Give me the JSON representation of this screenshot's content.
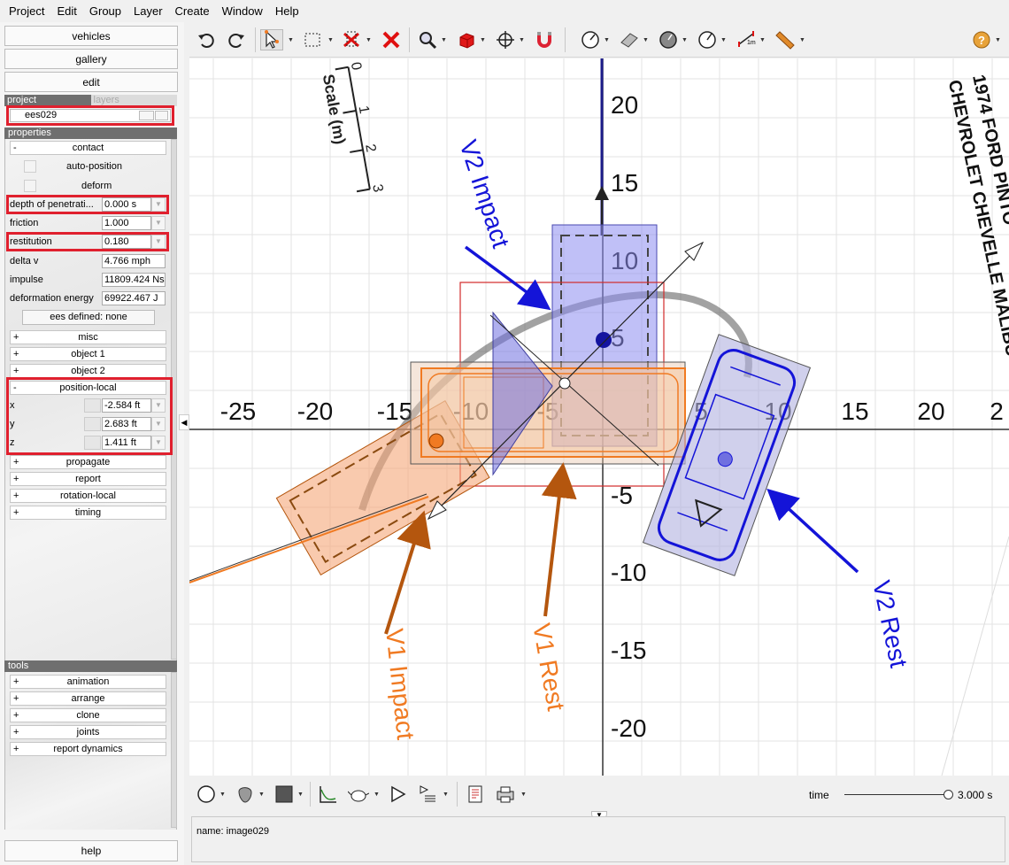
{
  "menu": [
    "Project",
    "Edit",
    "Group",
    "Layer",
    "Create",
    "Window",
    "Help"
  ],
  "left_panel": {
    "vehicles_label": "vehicles",
    "gallery_label": "gallery",
    "edit_label": "edit",
    "tab_project": "project",
    "tab_layers": "layers",
    "project_name": "ees029",
    "properties_heading": "properties",
    "contact_heading": "contact",
    "auto_position_label": "auto-position",
    "deform_label": "deform",
    "properties": {
      "depth_label": "depth of penetrati...",
      "depth_value": "0.000 s",
      "friction_label": "friction",
      "friction_value": "1.000",
      "restitution_label": "restitution",
      "restitution_value": "0.180",
      "delta_v_label": "delta v",
      "delta_v_value": "4.766 mph",
      "impulse_label": "impulse",
      "impulse_value": "11809.424 Ns",
      "deformation_energy_label": "deformation energy",
      "deformation_energy_value": "69922.467 J"
    },
    "ees_defined_label": "ees defined: none",
    "groups": {
      "misc": "misc",
      "object1": "object 1",
      "object2": "object 2",
      "position_local": "position-local",
      "propagate": "propagate",
      "report": "report",
      "rotation_local": "rotation-local",
      "timing": "timing"
    },
    "position": {
      "x_label": "x",
      "x_value": "-2.584 ft",
      "y_label": "y",
      "y_value": "2.683 ft",
      "z_label": "z",
      "z_value": "1.411 ft"
    },
    "tools_heading": "tools",
    "tools": [
      "animation",
      "arrange",
      "clone",
      "joints",
      "report dynamics"
    ],
    "help_label": "help",
    "plus": "+",
    "minus": "-"
  },
  "toolbar_icons": [
    "undo-icon",
    "redo-icon",
    "select-arrow-icon",
    "select-box-icon",
    "crop-x-icon",
    "delete-x-icon",
    "zoom-icon",
    "cube-icon",
    "move-icon",
    "magnet-icon",
    "dial-icon",
    "ramp-icon",
    "dial-filled-icon",
    "dial-outline-icon",
    "measure-1m-icon",
    "tape-icon",
    "help-icon"
  ],
  "measure_text": "1m",
  "diagram": {
    "x_ticks": [
      "-25",
      "-20",
      "-15",
      "-10",
      "-5",
      "5",
      "10",
      "15",
      "20",
      "2"
    ],
    "y_ticks": [
      "20",
      "15",
      "10",
      "5",
      "-5",
      "-10",
      "-15",
      "-20"
    ],
    "scale_label": "Scale (m)",
    "scale_ticks": [
      "0",
      "1",
      "2",
      "3"
    ],
    "annotations": {
      "v2_impact": "V2 Impact",
      "v1_impact": "V1 Impact",
      "v1_rest": "V1 Rest",
      "v2_rest": "V2 Rest",
      "vehicle_caption": "1974 FORD PINTO",
      "vehicle_caption2": "CHEVROLET CHEVELLE MALIBU"
    },
    "colors": {
      "v1": "#f07a22",
      "v2": "#1414d8",
      "v1_arrow": "#b4560e",
      "accent_red": "#e0202e"
    }
  },
  "bottom": {
    "icons": [
      "circle-icon",
      "blob-icon",
      "square-icon",
      "graph-icon",
      "teapot-icon",
      "play-icon",
      "play-list-icon",
      "report-icon",
      "print-icon"
    ],
    "time_label": "time",
    "time_value": "3.000 s",
    "time_progress": 1.0
  },
  "info": {
    "name_line": "name: image029"
  }
}
